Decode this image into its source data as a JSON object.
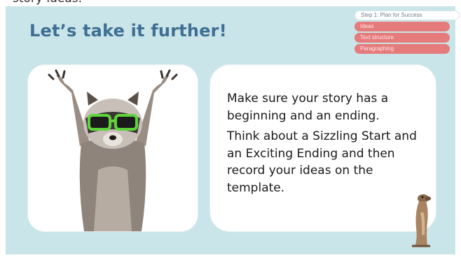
{
  "header_fragment": "story ideas.",
  "title": "Let’s take it further!",
  "nav": [
    {
      "label": "Step 1: Plan for Success",
      "active": true
    },
    {
      "label": "Ideas",
      "active": false
    },
    {
      "label": "Text structure",
      "active": false
    },
    {
      "label": "Paragraphing",
      "active": false
    }
  ],
  "content": {
    "paragraph1": "Make sure your story has a beginning and an ending.",
    "paragraph2": "Think about a Sizzling Start and an Exciting Ending and then record your ideas on the template."
  },
  "colors": {
    "slide_bg": "#c9e5e9",
    "title": "#3f6f92",
    "nav_pink": "#e57b7b",
    "glasses": "#5fd43a"
  },
  "icons": {
    "raccoon": "raccoon-illustration",
    "meerkat": "meerkat-illustration"
  }
}
